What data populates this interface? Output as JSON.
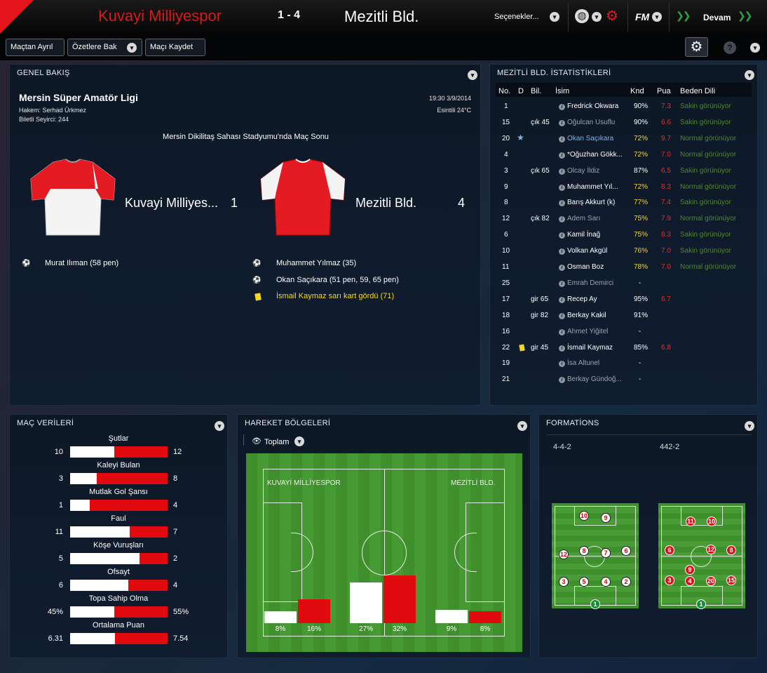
{
  "header": {
    "home_team": "Kuvayi Milliyespor",
    "score": "1 - 4",
    "away_team": "Mezitli Bld.",
    "options_label": "Seçenekler...",
    "fm_label": "FM",
    "continue_label": "Devam"
  },
  "toolbar": {
    "leave_label": "Maçtan Ayrıl",
    "highlights_label": "Özetlere Bak",
    "save_label": "Maçı Kaydet"
  },
  "overview": {
    "title": "GENEL BAKIŞ",
    "league": "Mersin Süper Amatör Ligi",
    "referee": "Hakem: Serhad Ürkmez",
    "attendance": "Biletli Seyirci: 244",
    "datetime": "19:30 3/9/2014",
    "weather": "Esintili 24°C",
    "stadium_line": "Mersin Dikilitaş Sahası Stadyumu'nda Maç Sonu",
    "home_name": "Kuvayi Milliyes...",
    "home_score": "1",
    "away_name": "Mezitli Bld.",
    "away_score": "4",
    "home_events": [
      "Murat Ilıman (58 pen)"
    ],
    "away_events": [
      "Muhammet Yılmaz (35)",
      "Okan Saçıkara (51 pen, 59, 65 pen)",
      "İsmail Kaymaz sarı kart gördü (71)"
    ]
  },
  "team_stats": {
    "title": "MEZİTLİ BLD. İSTATİSTİKLERİ",
    "columns": [
      "No.",
      "D",
      "Bil.",
      "İsim",
      "Knd",
      "Pua",
      "Beden Dili"
    ],
    "rows": [
      {
        "no": "1",
        "d": "",
        "bil": "",
        "name": "Fredrick Okwara",
        "knd": "90%",
        "pua": "7.3",
        "body": "Sakin görünüyor"
      },
      {
        "no": "15",
        "d": "",
        "bil": "çık 45",
        "name": "Oğulcan Usuflu",
        "knd": "90%",
        "pua": "6.6",
        "body": "Sakin görünüyor"
      },
      {
        "no": "20",
        "d": "★",
        "bil": "",
        "name": "Okan Saçıkara",
        "knd": "72%",
        "pua": "9.7",
        "body": "Normal görünüyor"
      },
      {
        "no": "4",
        "d": "",
        "bil": "",
        "name": "*Oğuzhan Gökk...",
        "knd": "72%",
        "pua": "7.0",
        "body": "Normal görünüyor"
      },
      {
        "no": "3",
        "d": "",
        "bil": "çık 65",
        "name": "Olcay İldiz",
        "knd": "87%",
        "pua": "6.5",
        "body": "Sakin görünüyor"
      },
      {
        "no": "9",
        "d": "",
        "bil": "",
        "name": "Muhammet Yıl...",
        "knd": "72%",
        "pua": "8.3",
        "body": "Normal görünüyor"
      },
      {
        "no": "8",
        "d": "",
        "bil": "",
        "name": "Barış Akkurt (k)",
        "knd": "77%",
        "pua": "7.4",
        "body": "Sakin görünüyor"
      },
      {
        "no": "12",
        "d": "",
        "bil": "çık 82",
        "name": "Adem Sarı",
        "knd": "75%",
        "pua": "7.9",
        "body": "Normal görünüyor"
      },
      {
        "no": "6",
        "d": "",
        "bil": "",
        "name": "Kamil İnağ",
        "knd": "75%",
        "pua": "8.3",
        "body": "Sakin görünüyor"
      },
      {
        "no": "10",
        "d": "",
        "bil": "",
        "name": "Volkan Akgül",
        "knd": "76%",
        "pua": "7.0",
        "body": "Sakin görünüyor"
      },
      {
        "no": "11",
        "d": "",
        "bil": "",
        "name": "Osman Boz",
        "knd": "78%",
        "pua": "7.0",
        "body": "Normal görünüyor"
      },
      {
        "no": "25",
        "d": "",
        "bil": "",
        "name": "Emrah Demirci",
        "knd": "-",
        "pua": "",
        "body": ""
      },
      {
        "no": "17",
        "d": "",
        "bil": "gir 65",
        "name": "Recep Ay",
        "knd": "95%",
        "pua": "6.7",
        "body": ""
      },
      {
        "no": "18",
        "d": "",
        "bil": "gir 82",
        "name": "Berkay Kakil",
        "knd": "91%",
        "pua": "",
        "body": ""
      },
      {
        "no": "16",
        "d": "",
        "bil": "",
        "name": "Ahmet Yiğitel",
        "knd": "-",
        "pua": "",
        "body": ""
      },
      {
        "no": "22",
        "d": "card",
        "bil": "gir 45",
        "name": "İsmail Kaymaz",
        "knd": "85%",
        "pua": "6.8",
        "body": ""
      },
      {
        "no": "19",
        "d": "",
        "bil": "",
        "name": "İsa Altunel",
        "knd": "-",
        "pua": "",
        "body": ""
      },
      {
        "no": "21",
        "d": "",
        "bil": "",
        "name": "Berkay Gündoğ...",
        "knd": "-",
        "pua": "",
        "body": ""
      }
    ]
  },
  "match_data": {
    "title": "MAÇ VERİLERİ",
    "stats": [
      {
        "label": "Şutlar",
        "home": "10",
        "away": "12",
        "home_frac": 0.45
      },
      {
        "label": "Kaleyi Bulan",
        "home": "3",
        "away": "8",
        "home_frac": 0.27
      },
      {
        "label": "Mutlak Gol Şansı",
        "home": "1",
        "away": "4",
        "home_frac": 0.2
      },
      {
        "label": "Faul",
        "home": "11",
        "away": "7",
        "home_frac": 0.61
      },
      {
        "label": "Köşe Vuruşları",
        "home": "5",
        "away": "2",
        "home_frac": 0.71
      },
      {
        "label": "Ofsayt",
        "home": "6",
        "away": "4",
        "home_frac": 0.6
      },
      {
        "label": "Topa Sahip Olma",
        "home": "45%",
        "away": "55%",
        "home_frac": 0.45
      },
      {
        "label": "Ortalama Puan",
        "home": "6.31",
        "away": "7.54",
        "home_frac": 0.46
      }
    ]
  },
  "movement": {
    "title": "HAREKET BÖLGELERİ",
    "filter_label": "Toplam",
    "home_label": "KUVAYİ MİLLİYESPOR",
    "away_label": "MEZİTLİ BLD.",
    "zones": [
      {
        "home": 8,
        "away": 16,
        "home_label": "8%",
        "away_label": "16%"
      },
      {
        "home": 27,
        "away": 32,
        "home_label": "27%",
        "away_label": "32%"
      },
      {
        "home": 9,
        "away": 8,
        "home_label": "9%",
        "away_label": "8%"
      }
    ]
  },
  "formations": {
    "title": "FORMATİONS",
    "home_formation": "4-4-2",
    "away_formation": "442-2",
    "home_players": [
      "10",
      "9",
      "12",
      "8",
      "7",
      "6",
      "3",
      "5",
      "4",
      "2",
      "1"
    ],
    "away_players": [
      "11",
      "10",
      "6",
      "12",
      "8",
      "9",
      "3",
      "4",
      "20",
      "15",
      "1"
    ]
  },
  "colors": {
    "home": "#ffffff",
    "away": "#e10a0e",
    "rating_red": "#e0302a",
    "knd_yellow": "#f0d23c",
    "body_green": "#4e8a2a"
  }
}
